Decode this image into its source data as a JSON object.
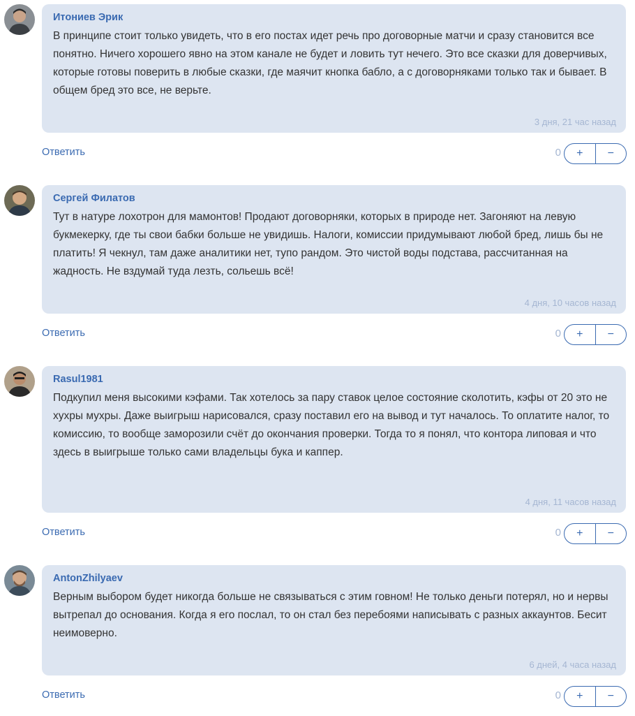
{
  "comments": [
    {
      "author": "Итониев Эрик",
      "text": "В принципе стоит только увидеть, что в его постах идет речь про договорные матчи и сразу становится все понятно. Ничего хорошего явно на этом канале не будет и ловить тут нечего. Это все сказки для доверчивых, которые готовы поверить в любые сказки, где маячит кнопка бабло, а с договорняками только так и бывает. В общем бред это все, не верьте.",
      "time": "3 дня, 21 час назад",
      "reply_label": "Ответить",
      "score": "0",
      "plus": "+",
      "minus": "−"
    },
    {
      "author": "Сергей Филатов",
      "text": "Тут в натуре лохотрон для мамонтов! Продают договорняки, которых в природе нет. Загоняют на левую букмекерку, где ты свои бабки больше не увидишь. Налоги, комиссии придумывают любой бред, лишь бы не платить! Я чекнул, там даже аналитики нет, тупо рандом. Это чистой воды подстава, рассчитанная на жадность. Не вздумай туда лезть, сольешь всё!",
      "time": "4 дня, 10 часов назад",
      "reply_label": "Ответить",
      "score": "0",
      "plus": "+",
      "minus": "−"
    },
    {
      "author": "Rasul1981",
      "text": "Подкупил меня высокими кэфами. Так хотелось за пару ставок целое состояние сколотить, кэфы от 20 это не хухры мухры. Даже выигрыш нарисовался, сразу поставил его на вывод и тут началось. То оплатите налог, то комиссию, то вообще заморозили счёт до окончания проверки. Тогда то я понял, что контора липовая и что здесь в выигрыше только сами владельцы бука и каппер.",
      "time": "4 дня, 11 часов назад",
      "reply_label": "Ответить",
      "score": "0",
      "plus": "+",
      "minus": "−"
    },
    {
      "author": "AntonZhilyaev",
      "text": "Верным выбором будет никогда больше не связываться с этим говном! Не только деньги потерял, но и нервы вытрепал до основания. Когда я его послал, то он стал без перебоями написывать с разных аккаунтов. Бесит неимоверно.",
      "time": "6 дней, 4 часа назад",
      "reply_label": "Ответить",
      "score": "0",
      "plus": "+",
      "minus": "−"
    }
  ]
}
